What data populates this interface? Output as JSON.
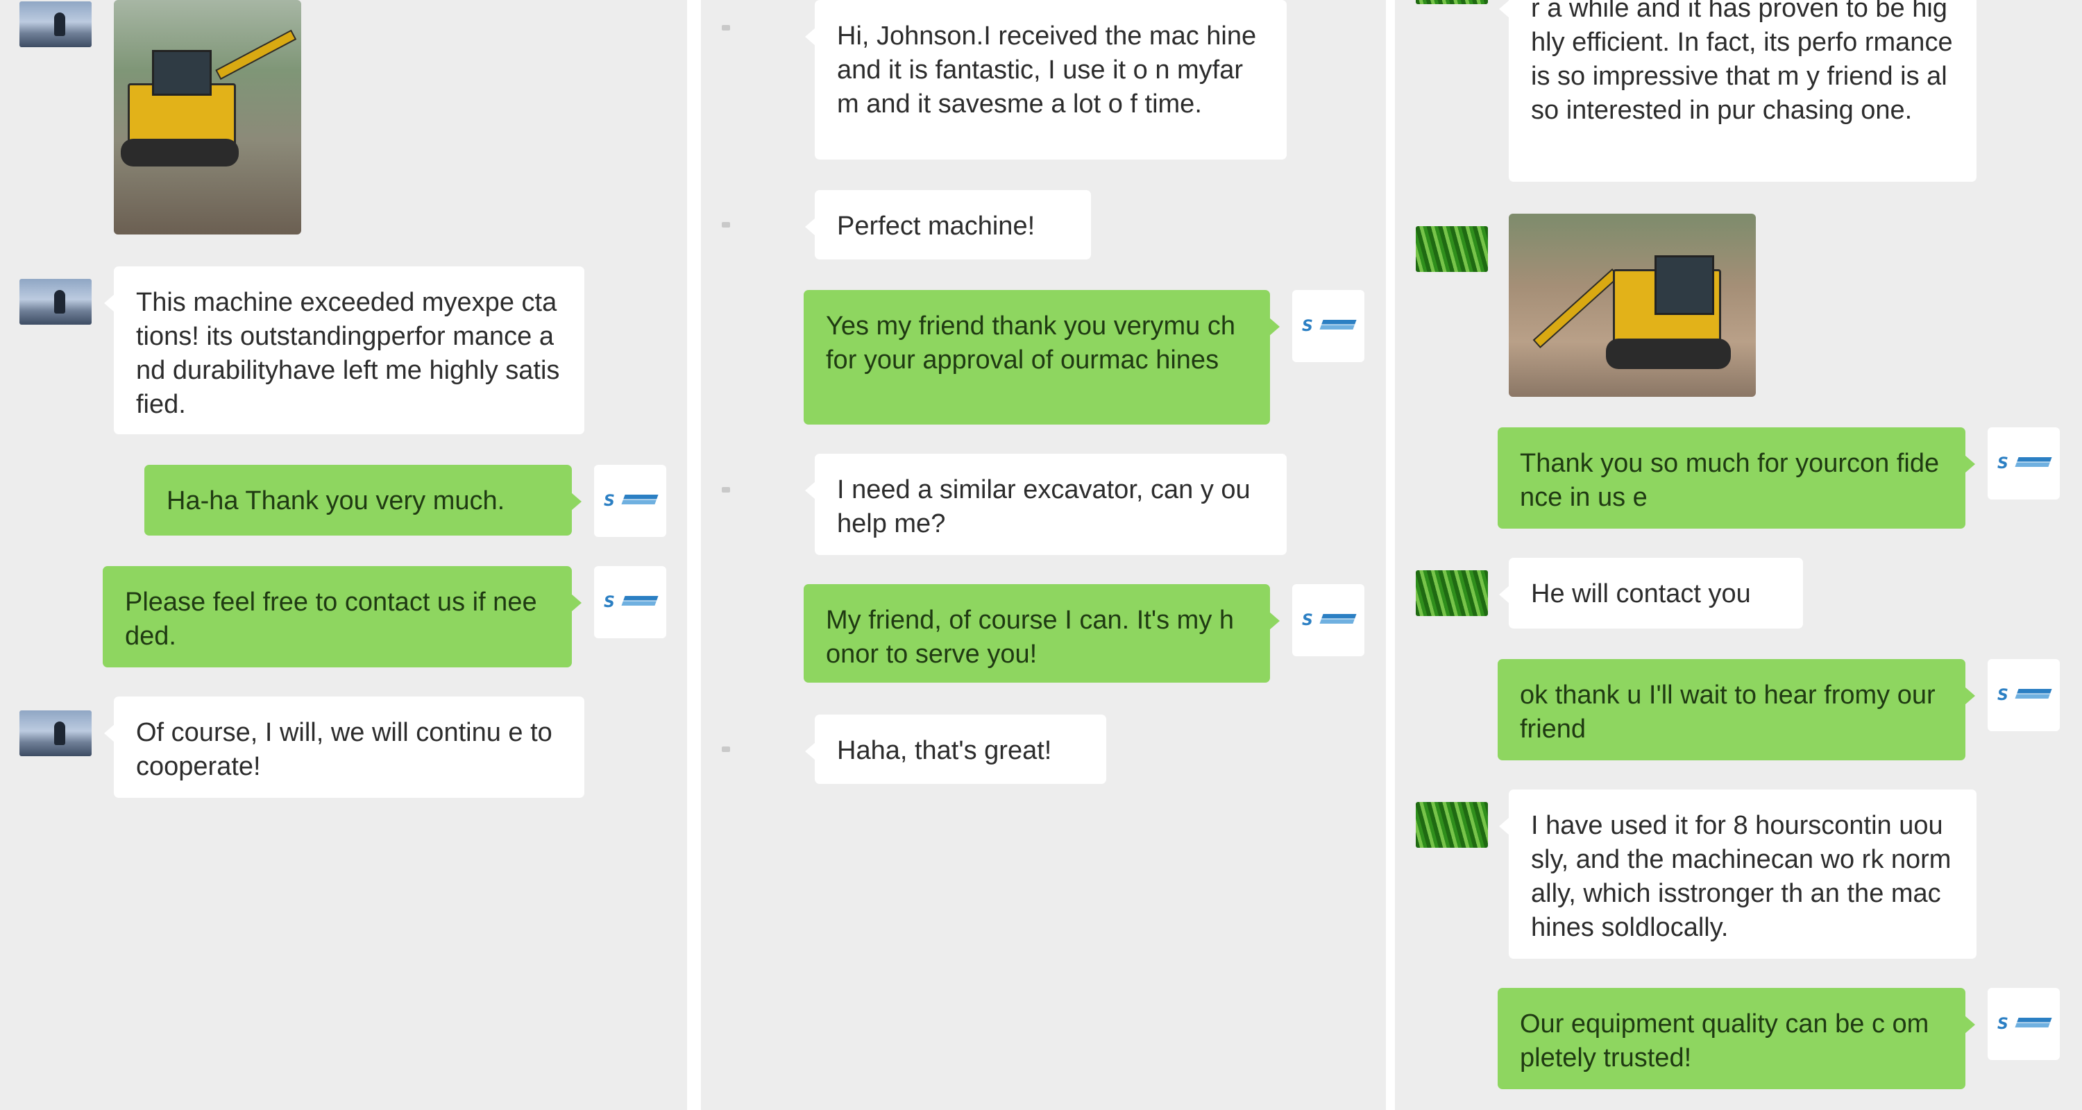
{
  "panels": [
    {
      "messages": [
        {
          "side": "left",
          "text": "This machine exceeded myexpe ctations! its outstandingperfor mance and durabilityhave left me highly satisfied."
        },
        {
          "side": "right",
          "text": "Ha-ha Thank you very much."
        },
        {
          "side": "right",
          "text": "Please feel free to contact us if needed."
        },
        {
          "side": "left",
          "text": "Of course, I will, we will continu e to cooperate!"
        }
      ]
    },
    {
      "messages": [
        {
          "side": "left",
          "text": "Hi, Johnson.I received the mac hineand it is fantastic, I use it o n myfarm and it savesme a lot o f time."
        },
        {
          "side": "left",
          "text": "Perfect machine!"
        },
        {
          "side": "right",
          "text": "Yes my friend thank you verymu ch for your approval of ourmac hines"
        },
        {
          "side": "left",
          "text": "I need a similar excavator, can y ou help me?"
        },
        {
          "side": "right",
          "text": "My friend, of course I can. It's my honor to serve you!"
        },
        {
          "side": "left",
          "text": "Haha, that's great!"
        }
      ]
    },
    {
      "messages": [
        {
          "side": "left",
          "text": "r a while and it has proven to be highly efficient. In fact, its perfo rmance is so impressive that m y friend is also interested in pur chasing one."
        },
        {
          "side": "right",
          "text": "Thank you so much for yourcon fidence in us e"
        },
        {
          "side": "left",
          "text": "He will contact you"
        },
        {
          "side": "right",
          "text": "ok thank u I'll wait to hear fromy our friend"
        },
        {
          "side": "left",
          "text": "I have used it for 8 hourscontin uously, and the machinecan wo rk normally, which isstronger th an the machines soldlocally."
        },
        {
          "side": "right",
          "text": "Our equipment quality can be c ompletely trusted!"
        }
      ]
    }
  ],
  "colors": {
    "background": "#ededed",
    "bubble_incoming": "#ffffff",
    "bubble_outgoing": "#8ed660"
  },
  "icons": {
    "customer_avatar_1": "person-silhouette-photo-avatar",
    "customer_avatar_2": "default-placeholder-avatar",
    "customer_avatar_3": "green-field-avatar",
    "seller_avatar": "company-logo-avatar",
    "shared_photo": "excavator-photo"
  }
}
